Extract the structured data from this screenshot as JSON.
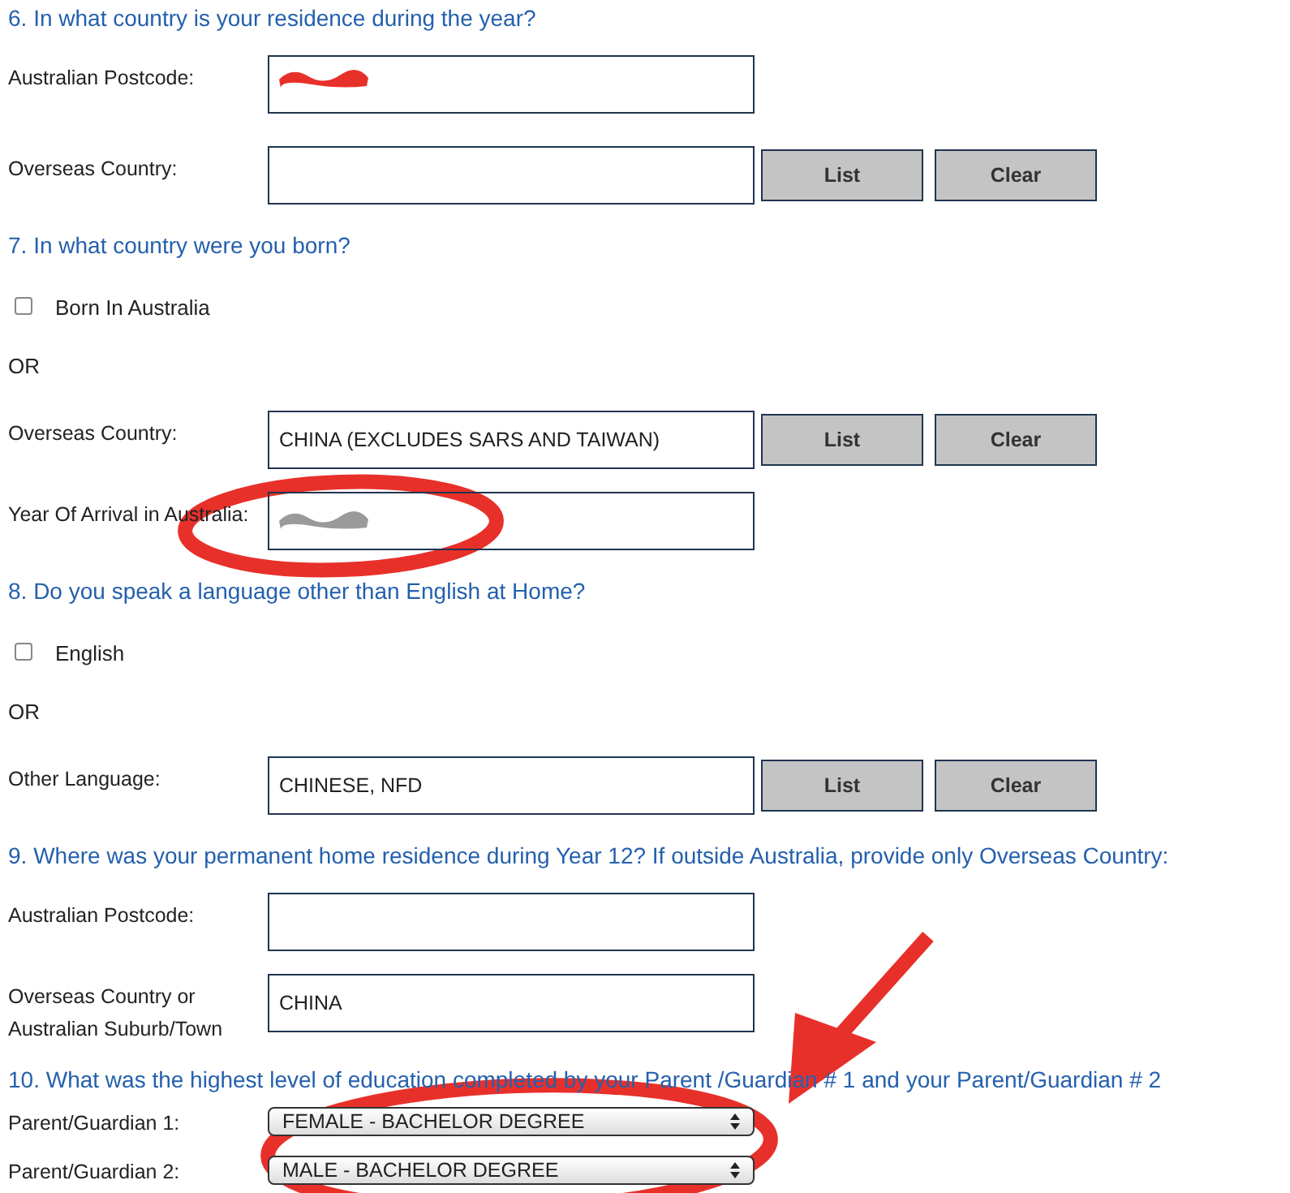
{
  "sections": [
    {
      "question": "6. In what country is your residence during the year?",
      "rows": [
        {
          "kind": "text",
          "label": "Australian Postcode:",
          "value": ""
        },
        {
          "kind": "text",
          "label": "Overseas Country:",
          "value": "",
          "buttons": [
            "List",
            "Clear"
          ]
        }
      ]
    },
    {
      "question": "7. In what country were you born?",
      "rows": [
        {
          "kind": "checkbox",
          "label": "Born In Australia",
          "checked": false
        },
        {
          "kind": "or",
          "label": "OR"
        },
        {
          "kind": "text",
          "label": "Overseas Country:",
          "value": "CHINA (EXCLUDES SARS AND TAIWAN)",
          "buttons": [
            "List",
            "Clear"
          ]
        },
        {
          "kind": "text",
          "label": "Year Of Arrival in Australia:",
          "value": ""
        }
      ]
    },
    {
      "question": "8. Do you speak a language other than English at Home?",
      "rows": [
        {
          "kind": "checkbox",
          "label": "English",
          "checked": false
        },
        {
          "kind": "or",
          "label": "OR"
        },
        {
          "kind": "text",
          "label": "Other Language:",
          "value": "CHINESE, NFD",
          "buttons": [
            "List",
            "Clear"
          ]
        }
      ]
    },
    {
      "question": "9. Where was your permanent home residence during Year 12? If outside Australia, provide only Overseas Country:",
      "rows": [
        {
          "kind": "text",
          "label": "Australian Postcode:",
          "value": ""
        },
        {
          "kind": "text",
          "label": "Overseas Country or Australian Suburb/Town",
          "value": "CHINA"
        }
      ]
    },
    {
      "question": "10. What was the highest level of education completed by your Parent /Guardian # 1 and your Parent/Guardian # 2",
      "rows": [
        {
          "kind": "select",
          "label": "Parent/Guardian 1:",
          "value": "FEMALE - BACHELOR DEGREE"
        },
        {
          "kind": "select",
          "label": "Parent/Guardian 2:",
          "value": "MALE - BACHELOR DEGREE"
        }
      ]
    }
  ],
  "annotations": [
    {
      "kind": "scribble"
    },
    {
      "kind": "blur"
    },
    {
      "kind": "ellipse"
    },
    {
      "kind": "ellipse"
    },
    {
      "kind": "arrow"
    }
  ]
}
